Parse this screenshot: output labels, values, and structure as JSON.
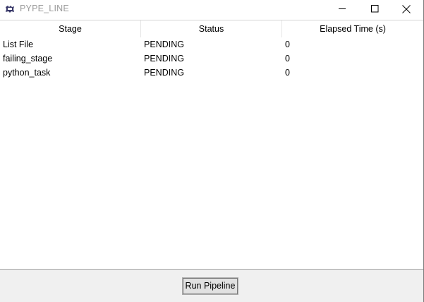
{
  "window": {
    "title": "PYPE_LINE",
    "icon": "feather-icon",
    "controls": {
      "minimize": "minimize-icon",
      "maximize": "maximize-icon",
      "close": "close-icon"
    }
  },
  "table": {
    "columns": [
      "Stage",
      "Status",
      "Elapsed Time (s)"
    ],
    "rows": [
      {
        "stage": "List File",
        "status": "PENDING",
        "elapsed": "0"
      },
      {
        "stage": "failing_stage",
        "status": "PENDING",
        "elapsed": "0"
      },
      {
        "stage": "python_task",
        "status": "PENDING",
        "elapsed": "0"
      }
    ]
  },
  "actions": {
    "run_label": "Run Pipeline"
  }
}
